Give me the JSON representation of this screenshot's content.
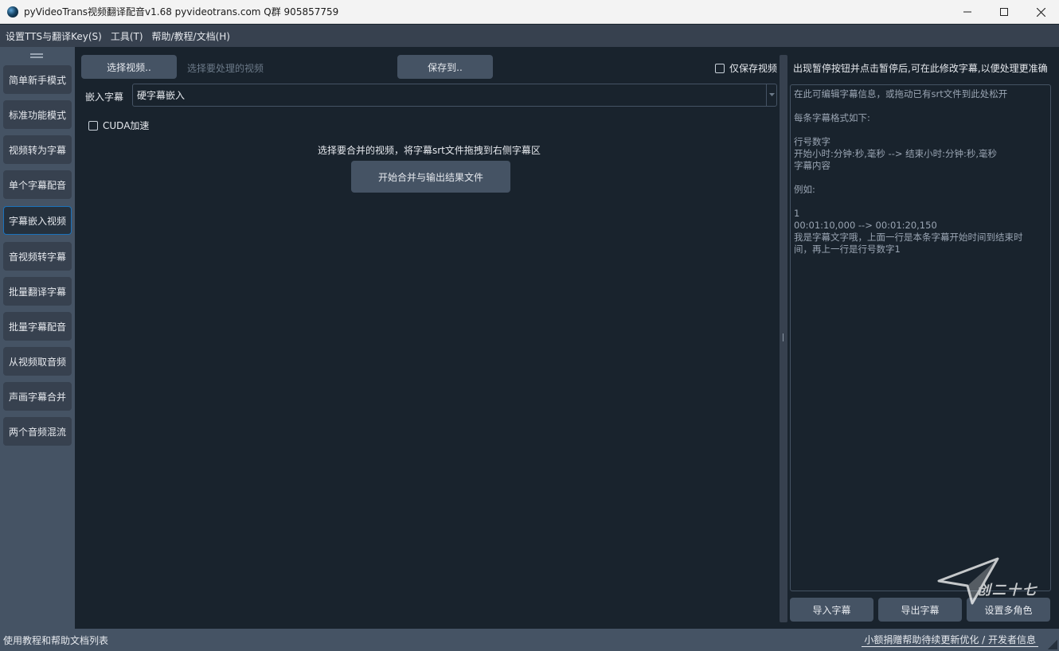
{
  "window": {
    "title": "pyVideoTrans视频翻译配音v1.68 pyvideotrans.com  Q群 905857759"
  },
  "menu": {
    "items": [
      "设置TTS与翻译Key(S)",
      "工具(T)",
      "帮助/教程/文档(H)"
    ]
  },
  "sidebar": {
    "items": [
      {
        "label": "简单新手模式",
        "active": false
      },
      {
        "label": "标准功能模式",
        "active": false
      },
      {
        "label": "视频转为字幕",
        "active": false
      },
      {
        "label": "单个字幕配音",
        "active": false
      },
      {
        "label": "字幕嵌入视频",
        "active": true
      },
      {
        "label": "音视频转字幕",
        "active": false
      },
      {
        "label": "批量翻译字幕",
        "active": false
      },
      {
        "label": "批量字幕配音",
        "active": false
      },
      {
        "label": "从视频取音频",
        "active": false
      },
      {
        "label": "声画字幕合并",
        "active": false
      },
      {
        "label": "两个音频混流",
        "active": false
      }
    ]
  },
  "main": {
    "select_video_label": "选择视频..",
    "video_path_placeholder": "选择要处理的视频",
    "save_to_label": "保存到..",
    "only_save_video_label": "仅保存视频",
    "only_save_video_checked": false,
    "embed_label": "嵌入字幕",
    "embed_selected": "硬字幕嵌入",
    "cuda_label": "CUDA加速",
    "cuda_checked": false,
    "hint": "选择要合并的视频，将字幕srt文件拖拽到右侧字幕区",
    "start_label": "开始合并与输出结果文件"
  },
  "right": {
    "title": "出现暂停按钮并点击暂停后,可在此修改字幕,以便处理更准确",
    "placeholder_lines": [
      "在此可编辑字幕信息，或拖动已有srt文件到此处松开",
      "",
      "每条字幕格式如下:",
      "",
      "行号数字",
      "开始小时:分钟:秒,毫秒 --> 结束小时:分钟:秒,毫秒",
      "字幕内容",
      "",
      "例如:",
      "",
      "1",
      "00:01:10,000 --> 00:01:20,150",
      "我是字幕文字哦，上面一行是本条字幕开始时间到结束时",
      "间，再上一行是行号数字1"
    ],
    "import_label": "导入字幕",
    "export_label": "导出字幕",
    "roles_label": "设置多角色"
  },
  "watermark": {
    "logo_text": "创二十七"
  },
  "status": {
    "left": "使用教程和帮助文档列表",
    "right": "小额捐赠帮助待续更新优化 / 开发者信息"
  },
  "colors": {
    "background": "#19232d",
    "panel": "#455364",
    "menubar": "#37414f",
    "accent": "#1a72bb",
    "text": "#e6e9ee",
    "muted": "#6c7a89"
  }
}
